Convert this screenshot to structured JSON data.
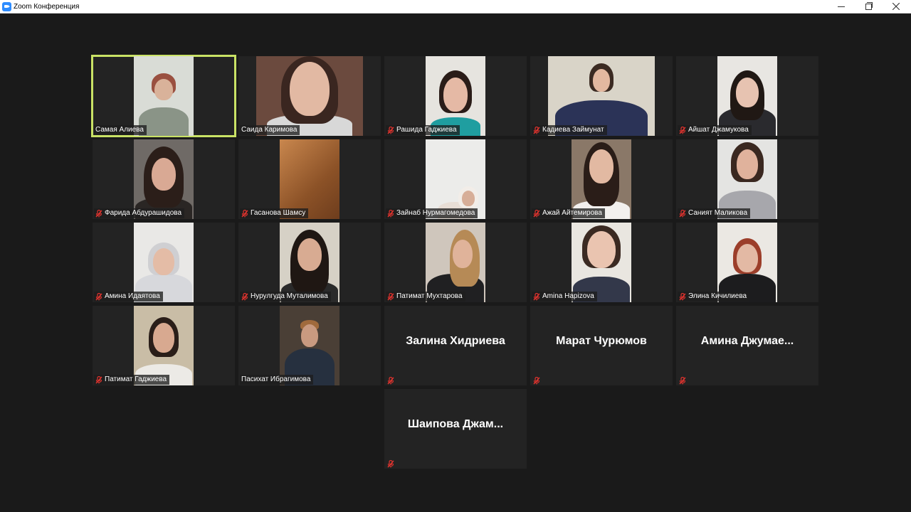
{
  "window": {
    "title": "Zoom Конференция"
  },
  "colors": {
    "active_speaker_border": "#c9e265",
    "mic_muted": "#e0332e",
    "tile_bg": "#232323"
  },
  "participants": [
    {
      "name": "Самая Алиева",
      "muted": false,
      "video": true,
      "active": true
    },
    {
      "name": "Саида Каримова",
      "muted": false,
      "video": true
    },
    {
      "name": "Рашида Гаджиева",
      "muted": true,
      "video": true
    },
    {
      "name": "Кадиева Займунат",
      "muted": true,
      "video": true
    },
    {
      "name": "Айшат Джамукова",
      "muted": true,
      "video": true
    },
    {
      "name": "Фарида Абдурашидова",
      "muted": true,
      "video": true
    },
    {
      "name": "Гасанова Шамсу",
      "muted": true,
      "video": true
    },
    {
      "name": "Зайнаб Нурмагомедова",
      "muted": true,
      "video": true
    },
    {
      "name": "Ажай Айтемирова",
      "muted": true,
      "video": true
    },
    {
      "name": "Саният Маликова",
      "muted": true,
      "video": true
    },
    {
      "name": "Амина Идаятова",
      "muted": true,
      "video": true
    },
    {
      "name": "Нурулгуда Муталимова",
      "muted": true,
      "video": true
    },
    {
      "name": "Патимат Мухтарова",
      "muted": true,
      "video": true
    },
    {
      "name": "Amina Hapizova",
      "muted": true,
      "video": true
    },
    {
      "name": "Элина Кичилиева",
      "muted": true,
      "video": true
    },
    {
      "name": "Патимат Гаджиева",
      "muted": true,
      "video": true
    },
    {
      "name": "Пасихат Ибрагимова",
      "muted": false,
      "video": true
    },
    {
      "name": "Залина Хидриева",
      "muted": true,
      "video": false
    },
    {
      "name": "Марат Чурюмов",
      "muted": true,
      "video": false
    },
    {
      "name": "Амина Джумае...",
      "muted": true,
      "video": false
    },
    {
      "name": "Шаипова Джам...",
      "muted": true,
      "video": false
    }
  ]
}
